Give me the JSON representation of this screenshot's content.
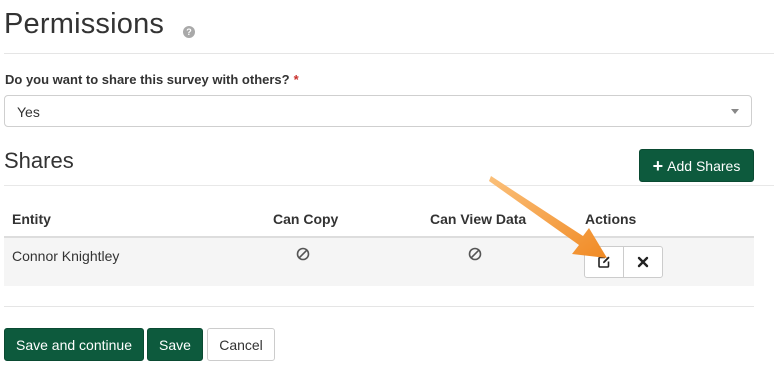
{
  "page": {
    "title": "Permissions"
  },
  "question": {
    "label": "Do you want to share this survey with others?",
    "required_marker": "*"
  },
  "share_select": {
    "value": "Yes"
  },
  "shares": {
    "title": "Shares",
    "add_button": "Add Shares",
    "columns": [
      "Entity",
      "Can Copy",
      "Can View Data",
      "Actions"
    ],
    "rows": [
      {
        "entity": "Connor Knightley",
        "can_copy": "not-allowed",
        "can_view_data": "not-allowed"
      }
    ]
  },
  "footer": {
    "save_continue": "Save and continue",
    "save": "Save",
    "cancel": "Cancel"
  },
  "icons": {
    "help": "question-circle-icon",
    "caret": "chevron-down-icon",
    "add": "plus-icon",
    "copy_status": "ban-icon",
    "edit": "edit-icon",
    "delete": "close-icon",
    "annotation": "pointer-arrow"
  },
  "colors": {
    "primary": "#0d5a3d",
    "required": "#c9302c",
    "annotation_arrow": "#f08a24",
    "row_background": "#f5f5f5"
  }
}
